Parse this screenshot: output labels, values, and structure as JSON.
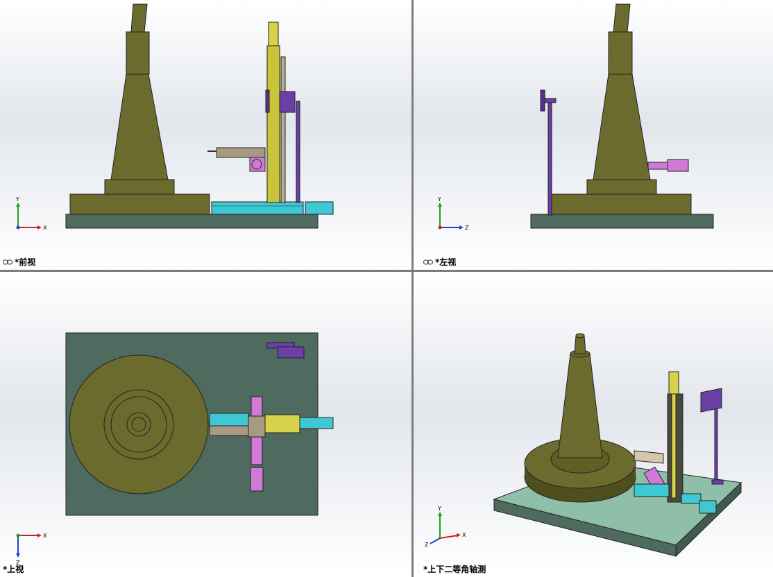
{
  "viewports": {
    "front": {
      "label": "*前视"
    },
    "left": {
      "label": "*左视"
    },
    "top": {
      "label": "*上视"
    },
    "iso": {
      "label": "*上下二等角轴测"
    }
  },
  "axes": {
    "x": "X",
    "y": "Y",
    "z": "Z"
  },
  "colors": {
    "olive": "#6b6b2e",
    "olive_dark": "#4f4f1e",
    "base_plate": "#4f6a5e",
    "base_plate_iso": "#8fbfa8",
    "cyan": "#3fc7d4",
    "purple": "#6a3fa8",
    "magenta": "#d07ad6",
    "yellow": "#d8d24a",
    "tan": "#a89a80"
  },
  "icons": {
    "link": "link-icon"
  }
}
